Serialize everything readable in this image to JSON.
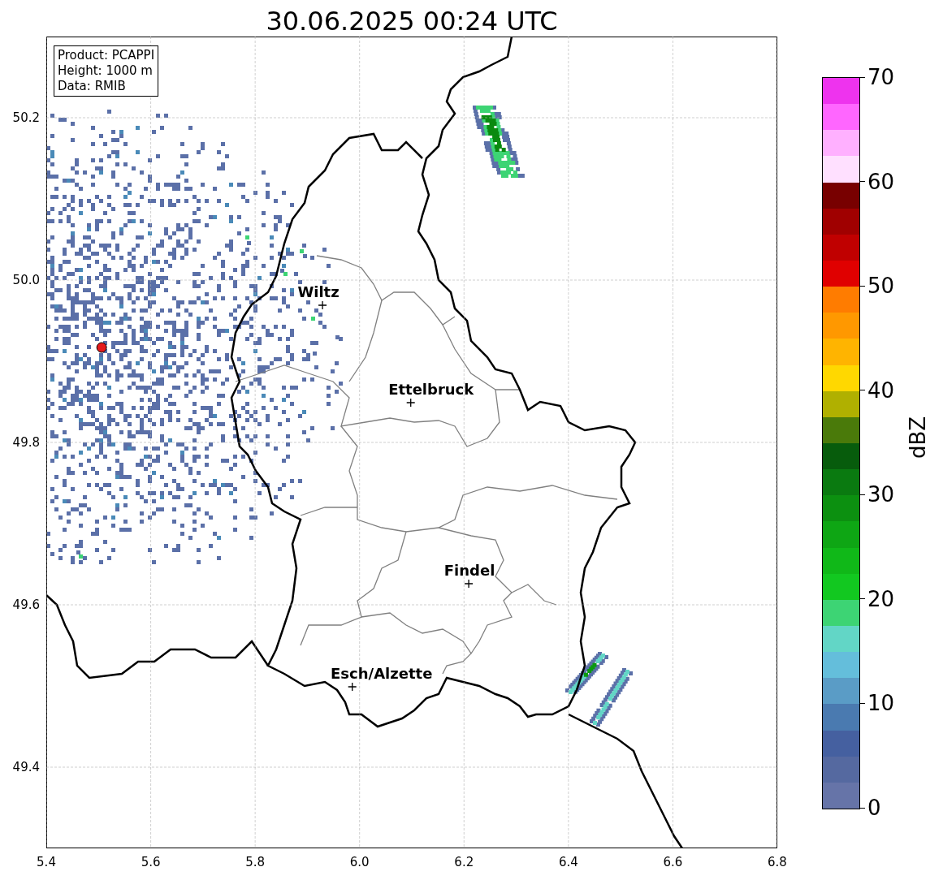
{
  "title": "30.06.2025 00:24 UTC",
  "info_box": [
    "Product: PCAPPI",
    "Height: 1000 m",
    "Data: RMIB"
  ],
  "map": {
    "chart_data": {
      "type": "scatter",
      "xlim": [
        5.4,
        6.8
      ],
      "ylim": [
        49.3,
        50.3
      ],
      "xticks": [
        {
          "value": 5.4,
          "label": "5.4"
        },
        {
          "value": 5.6,
          "label": "5.6"
        },
        {
          "value": 5.8,
          "label": "5.8"
        },
        {
          "value": 6.0,
          "label": "6.0"
        },
        {
          "value": 6.2,
          "label": "6.2"
        },
        {
          "value": 6.4,
          "label": "6.4"
        },
        {
          "value": 6.6,
          "label": "6.6"
        },
        {
          "value": 6.8,
          "label": "6.8"
        }
      ],
      "yticks": [
        {
          "value": 49.4,
          "label": "49.4"
        },
        {
          "value": 49.6,
          "label": "49.6"
        },
        {
          "value": 49.8,
          "label": "49.8"
        },
        {
          "value": 50.0,
          "label": "50.0"
        },
        {
          "value": 50.2,
          "label": "50.2"
        }
      ],
      "series": [
        {
          "color": "#000000",
          "x": [
            5.929,
            6.098,
            6.209,
            5.986
          ],
          "values": [
            49.969,
            49.849,
            49.626,
            49.499
          ]
        },
        {
          "color": "#e41a1c",
          "x": [
            5.506
          ],
          "values": [
            49.917
          ]
        }
      ],
      "grid": true,
      "annotations": [
        "Wiltz",
        "Ettelbruck",
        "Findel",
        "Esch/Alzette"
      ]
    }
  },
  "colorbar": {
    "label": "dBZ",
    "ticks": [
      "70",
      "60",
      "50",
      "40",
      "30",
      "20",
      "10",
      "0"
    ],
    "bands": [
      {
        "color": "#ee33ee"
      },
      {
        "color": "#ff66ff"
      },
      {
        "color": "#ffb0ff"
      },
      {
        "color": "#ffe0ff"
      },
      {
        "color": "#780000"
      },
      {
        "color": "#a00000"
      },
      {
        "color": "#c00000"
      },
      {
        "color": "#e00000"
      },
      {
        "color": "#ff7c00"
      },
      {
        "color": "#ff9800"
      },
      {
        "color": "#ffb400"
      },
      {
        "color": "#ffd800"
      },
      {
        "color": "#b0b000"
      },
      {
        "color": "#4a7a0a"
      },
      {
        "color": "#075c0c"
      },
      {
        "color": "#0a7a10"
      },
      {
        "color": "#0c9010"
      },
      {
        "color": "#0ea614"
      },
      {
        "color": "#10b818"
      },
      {
        "color": "#12c820"
      },
      {
        "color": "#3dd474"
      },
      {
        "color": "#62d6c6"
      },
      {
        "color": "#64bedb"
      },
      {
        "color": "#5a9cc6"
      },
      {
        "color": "#4a7ab0"
      },
      {
        "color": "#4560a0"
      },
      {
        "color": "#5569a0"
      },
      {
        "color": "#6674a8"
      }
    ]
  }
}
